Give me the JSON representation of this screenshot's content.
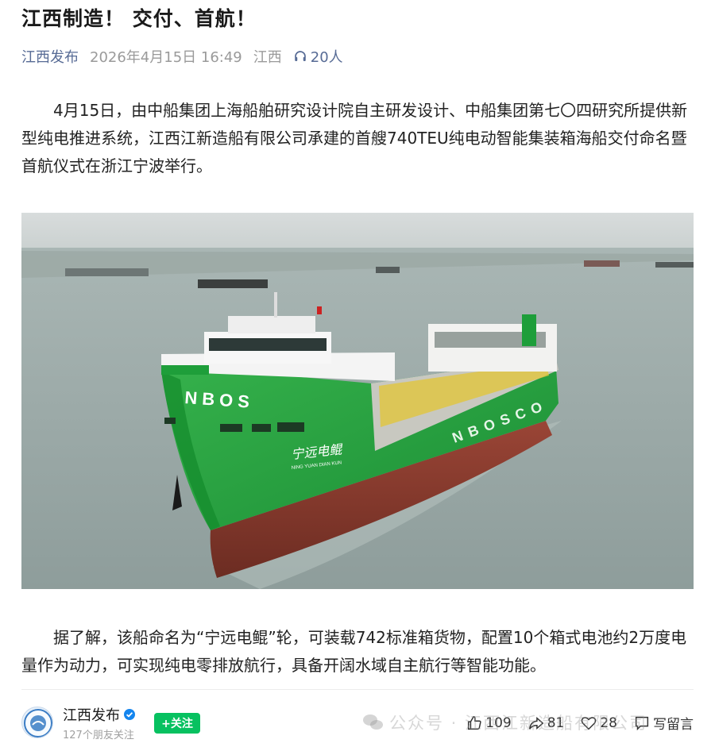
{
  "article": {
    "title": "江西制造！ 交付、首航！",
    "account": "江西发布",
    "date": "2026年4月15日 16:49",
    "region": "江西",
    "listeners": "20人",
    "paragraph1": "4月15日，由中船集团上海船舶研究设计院自主研发设计、中船集团第七〇四研究所提供新型纯电推进系统，江西江新造船有限公司承建的首艘740TEU纯电动智能集装箱海船交付命名暨首航仪式在浙江宁波举行。",
    "paragraph2": "据了解，该船命名为“宁远电鲲”轮，可装载742标准箱货物，配置10个箱式电池约2万度电量作为动力，可实现纯电零排放航行，具备开阔水域自主航行等智能功能。"
  },
  "photo": {
    "hull_text": "NBOS",
    "side_text": "NBOSCO",
    "ship_name": "宁远电鲲",
    "ship_pinyin": "NING YUAN DIAN KUN"
  },
  "footer": {
    "account_name": "江西发布",
    "friends": "127个朋友关注",
    "follow_label": "+关注",
    "share_count": "109",
    "forward_count": "81",
    "like_count": "28",
    "comment_label": "写留言"
  },
  "watermark": "公众号 · 江西江新造船有限公司",
  "colors": {
    "accent_link": "#576b95",
    "follow_green": "#07c160",
    "hull_green": "#1e9e3a",
    "hull_red": "#8a3a2e"
  }
}
